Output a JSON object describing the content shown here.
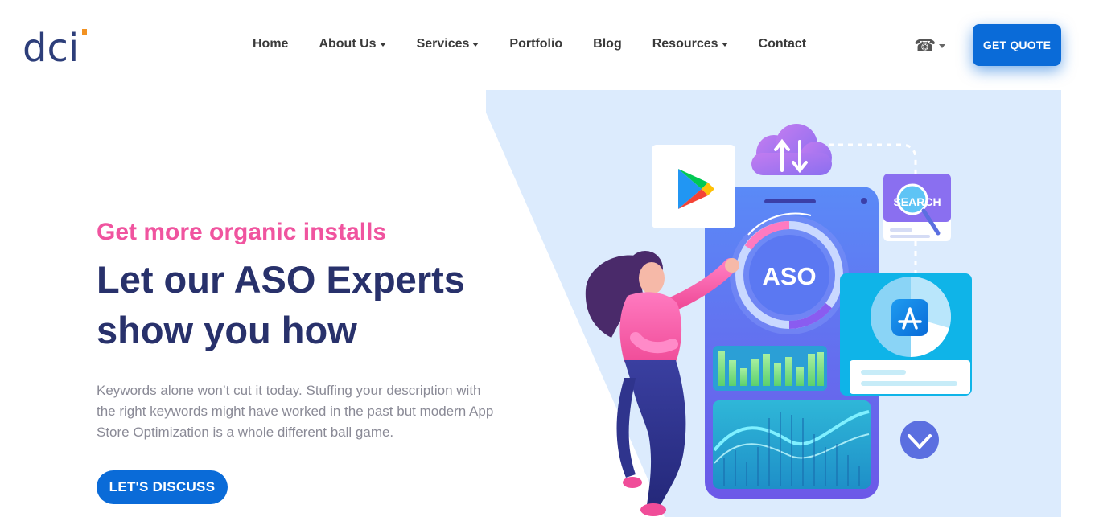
{
  "header": {
    "logo_text": "dci",
    "nav": [
      {
        "label": "Home",
        "dropdown": false
      },
      {
        "label": "About Us",
        "dropdown": true
      },
      {
        "label": "Services",
        "dropdown": true
      },
      {
        "label": "Portfolio",
        "dropdown": false
      },
      {
        "label": "Blog",
        "dropdown": false
      },
      {
        "label": "Resources",
        "dropdown": true
      },
      {
        "label": "Contact",
        "dropdown": false
      }
    ],
    "phone_icon": "☎",
    "get_quote_label": "GET QUOTE"
  },
  "hero": {
    "eyebrow": "Get more organic installs",
    "headline": "Let our ASO Experts show you how",
    "description": "Keywords alone won’t cut it today. Stuffing your description with the right keywords might have worked in the past but modern App Store Optimization is a whole different ball game.",
    "cta_label": "LET'S DISCUSS"
  },
  "illustration": {
    "aso_label": "ASO",
    "search_label": "SEARCH"
  },
  "colors": {
    "accent": "#0a6bd8",
    "eyebrow": "#f0549f",
    "headline": "#28316b",
    "hero_bg": "#dcebfd"
  }
}
